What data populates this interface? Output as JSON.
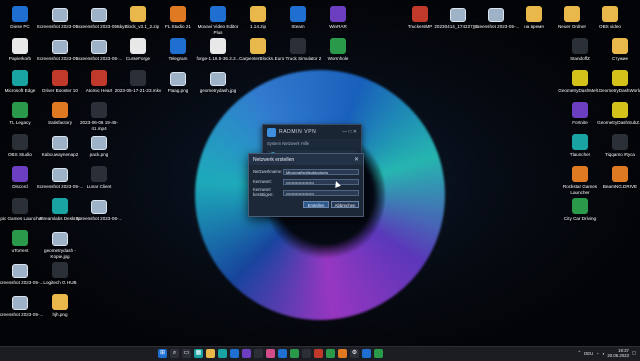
{
  "desktop": {
    "left_icons": [
      {
        "label": "Diese PC",
        "icon": "pc-icon",
        "cls": "blue"
      },
      {
        "label": "Papierkorb",
        "icon": "recycle-bin-icon",
        "cls": "white"
      },
      {
        "label": "Microsoft Edge",
        "icon": "edge-icon",
        "cls": "teal"
      },
      {
        "label": "TL Legacy",
        "icon": "tl-legacy-icon",
        "cls": "green"
      },
      {
        "label": "OBS Studio",
        "icon": "obs-icon",
        "cls": "dark"
      },
      {
        "label": "Discord",
        "icon": "discord-icon",
        "cls": "purple"
      },
      {
        "label": "Epic Games Launcher",
        "icon": "epic-icon",
        "cls": "dark"
      },
      {
        "label": "uTorrent",
        "icon": "utorrent-icon",
        "cls": "green"
      },
      {
        "label": "Screenshot 2023-05-...",
        "icon": "screenshot-icon",
        "cls": "shot"
      },
      {
        "label": "Screenshot 2023-05-...",
        "icon": "screenshot-icon",
        "cls": "shot"
      }
    ],
    "col2_icons": [
      {
        "label": "Screenshot 2023-05-...",
        "icon": "screenshot-icon",
        "cls": "shot"
      },
      {
        "label": "Screenshot 2023-05-...",
        "icon": "screenshot-icon",
        "cls": "shot"
      },
      {
        "label": "Driver Booster 10",
        "icon": "driver-booster-icon",
        "cls": "red"
      },
      {
        "label": "Satisfactory",
        "icon": "satisfactory-icon",
        "cls": "orange"
      },
      {
        "label": "Kabcuwaynenap2",
        "icon": "image-file-icon",
        "cls": "shot"
      },
      {
        "label": "Screenshot 2023-05-...",
        "icon": "screenshot-icon",
        "cls": "shot"
      },
      {
        "label": "Streamlabs Desktop",
        "icon": "streamlabs-icon",
        "cls": "teal"
      },
      {
        "label": "geometrydash - Kopie.jpg",
        "icon": "image-file-icon",
        "cls": "shot"
      },
      {
        "label": "Logitech G HUB",
        "icon": "logitech-icon",
        "cls": "dark"
      },
      {
        "label": "hjh.png",
        "icon": "image-file-icon",
        "cls": "folder"
      }
    ],
    "col3_icons": [
      {
        "label": "Screenshot 2023-05-...",
        "icon": "screenshot-icon",
        "cls": "shot"
      },
      {
        "label": "Screenshot 2023-05-...",
        "icon": "screenshot-icon",
        "cls": "shot"
      },
      {
        "label": "Atomic Heart",
        "icon": "atomic-heart-icon",
        "cls": "red"
      },
      {
        "label": "2023-06-06 19-45-41.mp4",
        "icon": "video-file-icon",
        "cls": "dark"
      },
      {
        "label": "pack.png",
        "icon": "image-file-icon",
        "cls": "shot"
      },
      {
        "label": "Lunar Client",
        "icon": "lunar-client-icon",
        "cls": "dark"
      },
      {
        "label": "Screenshot 2023-06-...",
        "icon": "screenshot-icon",
        "cls": "shot"
      }
    ],
    "top_row": [
      {
        "label": "SkyBlock_v3.1_2.zip",
        "icon": "zip-icon",
        "cls": "folder"
      },
      {
        "label": "FL Studio 21",
        "icon": "fl-studio-icon",
        "cls": "orange"
      },
      {
        "label": "Movavi Video Editor Plus",
        "icon": "movavi-icon",
        "cls": "blue"
      },
      {
        "label": "1.14.zip",
        "icon": "zip-icon",
        "cls": "folder"
      },
      {
        "label": "Steam",
        "icon": "steam-icon",
        "cls": "blue"
      },
      {
        "label": "WinRAR",
        "icon": "winrar-icon",
        "cls": "purple"
      }
    ],
    "second_row": [
      {
        "label": "CurseForge",
        "icon": "curseforge-icon",
        "cls": "white"
      },
      {
        "label": "Telegram",
        "icon": "telegram-icon",
        "cls": "blue"
      },
      {
        "label": "forge-1.16.5-36.2.2...",
        "icon": "java-file-icon",
        "cls": "white"
      },
      {
        "label": "CarpenterBlocks...",
        "icon": "folder-icon",
        "cls": "folder"
      },
      {
        "label": "Euro Truck Simulator 2",
        "icon": "ets2-icon",
        "cls": "dark"
      },
      {
        "label": "Wormhole",
        "icon": "wormhole-icon",
        "cls": "green"
      }
    ],
    "third_row": [
      {
        "label": "2023-05-17-21-23.mkv",
        "icon": "video-file-icon",
        "cls": "dark"
      },
      {
        "label": "Ftaag.png",
        "icon": "image-file-icon",
        "cls": "shot"
      },
      {
        "label": "geometrydash.jpg",
        "icon": "image-file-icon",
        "cls": "shot"
      }
    ],
    "right_top": [
      {
        "label": "TruckersMP",
        "icon": "truckersmp-icon",
        "cls": "red"
      },
      {
        "label": "20230414_174227_0...",
        "icon": "image-file-icon",
        "cls": "shot"
      },
      {
        "label": "Screenshot 2023-05-...",
        "icon": "screenshot-icon",
        "cls": "shot"
      },
      {
        "label": "на время",
        "icon": "folder-icon",
        "cls": "folder"
      },
      {
        "label": "Neuer Ordner",
        "icon": "folder-icon",
        "cls": "folder"
      },
      {
        "label": "OBS video",
        "icon": "folder-icon",
        "cls": "folder"
      }
    ],
    "right_col": [
      {
        "label": "StandoffZ",
        "icon": "standoff-icon",
        "cls": "dark"
      },
      {
        "label": "Стужие",
        "icon": "folder-icon",
        "cls": "folder"
      },
      {
        "label": "GeometryDashMelt...",
        "icon": "geometry-dash-icon",
        "cls": "yellow"
      },
      {
        "label": "GeometryDashWorld",
        "icon": "geometry-dash-icon",
        "cls": "yellow"
      },
      {
        "label": "Fortnite",
        "icon": "fortnite-icon",
        "cls": "purple"
      },
      {
        "label": "GeometryDashSubZ...",
        "icon": "geometry-dash-icon",
        "cls": "yellow"
      },
      {
        "label": "Tlauncher",
        "icon": "tlauncher-icon",
        "cls": "teal"
      },
      {
        "label": "Tiqqamo #tyca",
        "icon": "app-icon",
        "cls": "dark"
      },
      {
        "label": "Rockstar Games Launcher",
        "icon": "rockstar-icon",
        "cls": "orange"
      },
      {
        "label": "BeamNG.DRIVE",
        "icon": "beamng-icon",
        "cls": "orange"
      },
      {
        "label": "City Car Driving",
        "icon": "city-car-icon",
        "cls": "green"
      }
    ]
  },
  "radmin": {
    "title": "RADMIN VPN",
    "controls": "— □ ✕",
    "menu": "System  Netzwerk  Hilfe",
    "network": "SASCHA"
  },
  "dialog": {
    "title": "Netzwerk erstellen",
    "close": "✕",
    "name_label": "Netzwerkname:",
    "name_value": "Minecraftsnitsubtockers",
    "pw_label": "Kennwort:",
    "pw_value": "••••••••••••••••••••",
    "pw2_label": "Kennwort bestätigen:",
    "pw2_value": "••••••••••••••••••••",
    "create": "Erstellen",
    "cancel": "Abbrechen"
  },
  "taskbar": {
    "apps": [
      {
        "icon": "start-icon",
        "cls": "blue",
        "glyph": "⊞"
      },
      {
        "icon": "search-icon",
        "cls": "dark",
        "glyph": "⌕"
      },
      {
        "icon": "task-view-icon",
        "cls": "dark",
        "glyph": "▭"
      },
      {
        "icon": "widgets-icon",
        "cls": "teal",
        "glyph": "▦"
      },
      {
        "icon": "file-explorer-icon",
        "cls": "folder",
        "glyph": ""
      },
      {
        "icon": "edge-icon",
        "cls": "teal",
        "glyph": ""
      },
      {
        "icon": "store-icon",
        "cls": "blue",
        "glyph": ""
      },
      {
        "icon": "discord-icon",
        "cls": "purple",
        "glyph": ""
      },
      {
        "icon": "steam-icon",
        "cls": "dark",
        "glyph": ""
      },
      {
        "icon": "instagram-icon",
        "cls": "pink",
        "glyph": ""
      },
      {
        "icon": "telegram-icon",
        "cls": "blue",
        "glyph": ""
      },
      {
        "icon": "chrome-icon",
        "cls": "green",
        "glyph": ""
      },
      {
        "icon": "obs-icon",
        "cls": "dark",
        "glyph": ""
      },
      {
        "icon": "opera-icon",
        "cls": "red",
        "glyph": ""
      },
      {
        "icon": "minecraft-icon",
        "cls": "green",
        "glyph": ""
      },
      {
        "icon": "vlc-icon",
        "cls": "orange",
        "glyph": ""
      },
      {
        "icon": "settings-icon",
        "cls": "dark",
        "glyph": "⚙"
      },
      {
        "icon": "radmin-icon",
        "cls": "blue",
        "glyph": ""
      },
      {
        "icon": "nvidia-icon",
        "cls": "green",
        "glyph": ""
      }
    ],
    "lang": "DEU",
    "time": "19:37",
    "date": "20.06.2023"
  }
}
